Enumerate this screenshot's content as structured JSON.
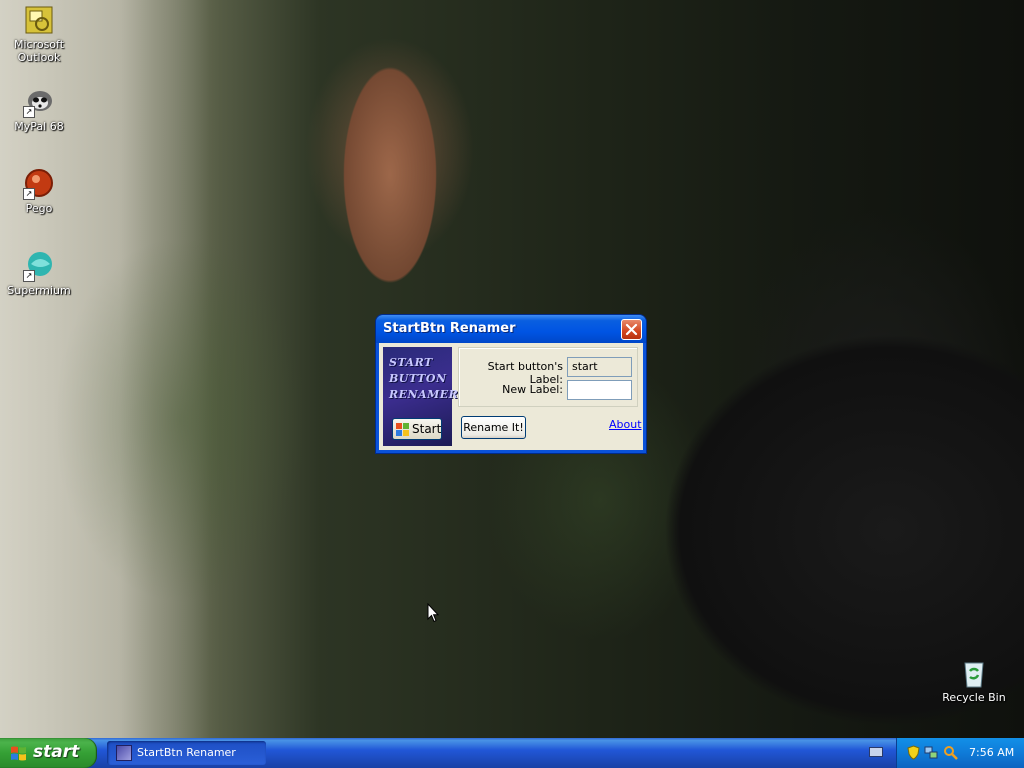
{
  "desktop": {
    "icons": [
      {
        "label": "Microsoft Outlook",
        "icon": "outlook-icon"
      },
      {
        "label": "MyPal 68",
        "icon": "mypal-icon",
        "shortcut": true
      },
      {
        "label": "Pego",
        "icon": "pego-icon",
        "shortcut": true
      },
      {
        "label": "Supermium",
        "icon": "supermium-icon",
        "shortcut": true
      },
      {
        "label": "Recycle Bin",
        "icon": "recycle-bin-icon"
      }
    ]
  },
  "window": {
    "title": "StartBtn Renamer",
    "logo_text_lines": [
      "START",
      "BUTTON",
      "RENAMER"
    ],
    "logo_button_label": "Start",
    "current_label_caption": "Start button's Label:",
    "current_label_value": "start",
    "new_label_caption": "New Label:",
    "new_label_value": "",
    "rename_button": "Rename It!",
    "about_link": "About"
  },
  "taskbar": {
    "start_label": "start",
    "tasks": [
      {
        "label": "StartBtn Renamer"
      }
    ],
    "clock": "7:56 AM"
  },
  "colors": {
    "titlebar": "#0054e3",
    "taskbar": "#245edb",
    "start_button": "#3c9e3c",
    "tray": "#0f7bd8",
    "dialog_face": "#ece9d8",
    "link": "#0000ff"
  }
}
